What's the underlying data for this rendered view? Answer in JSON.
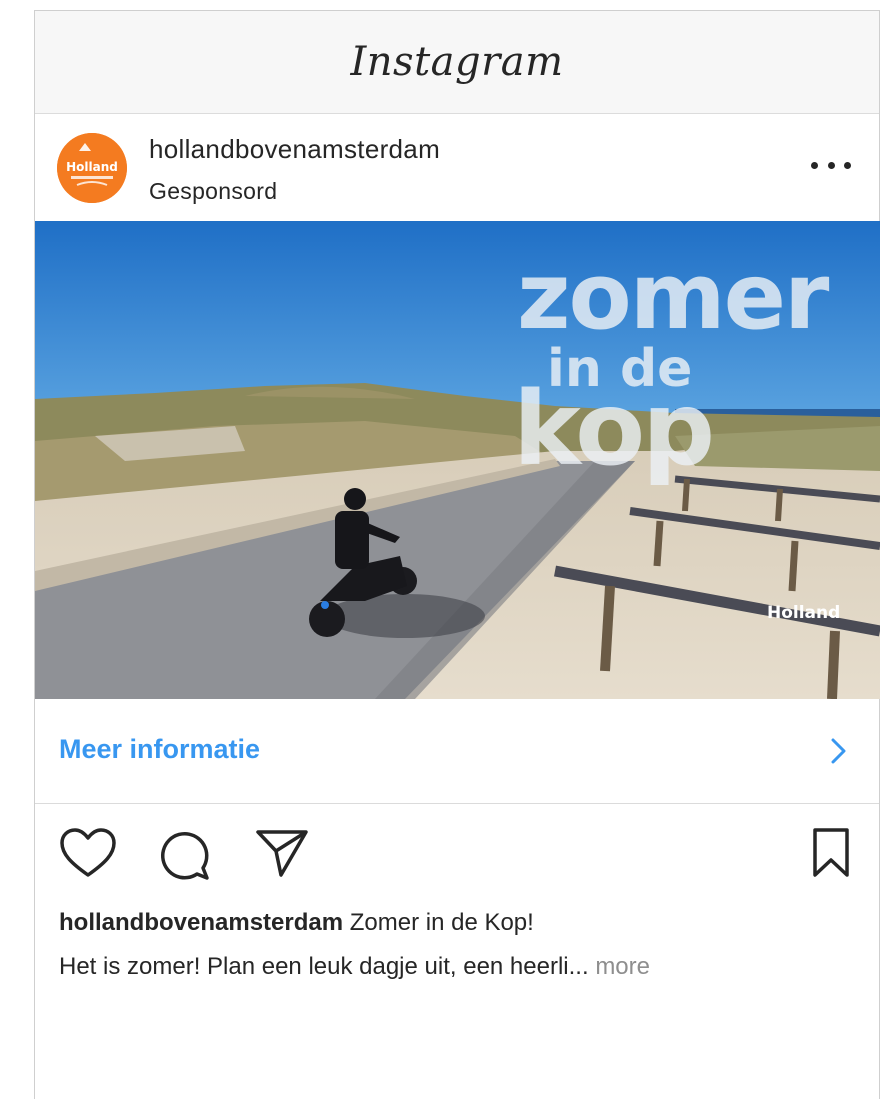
{
  "app": {
    "title": "Instagram"
  },
  "post": {
    "username": "hollandbovenamsterdam",
    "sponsored_label": "Gesponsord",
    "avatar_text": "Holland",
    "media_overlay": {
      "line1": "zomer",
      "line2": "in de",
      "line3": "kop",
      "logo": "Holland"
    },
    "cta_label": "Meer informatie",
    "caption_title": "Zomer in de Kop!",
    "caption_body": "Het is zomer! Plan een leuk dagje uit, een heerli...",
    "more_label": "more"
  },
  "icons": {
    "more": "more-horizontal-icon",
    "like": "heart-icon",
    "comment": "comment-icon",
    "share": "paper-plane-icon",
    "save": "bookmark-icon",
    "cta": "chevron-right-icon"
  },
  "colors": {
    "link": "#3897f0",
    "avatar": "#f47b20",
    "text": "#262626",
    "muted": "#8e8e8e"
  }
}
